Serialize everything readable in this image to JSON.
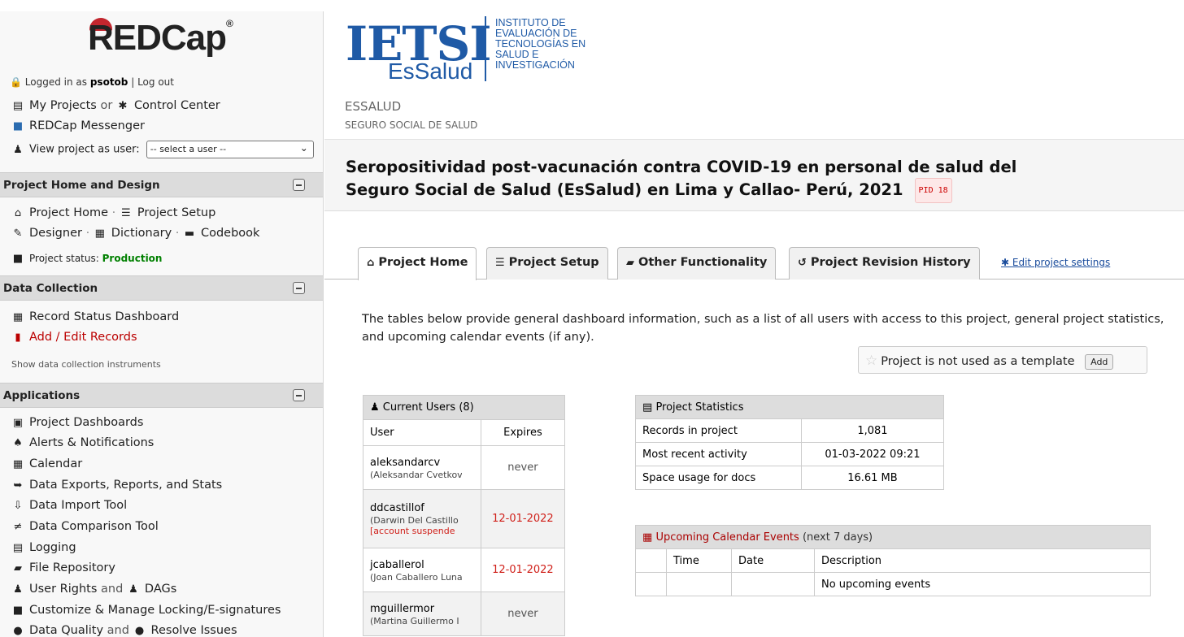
{
  "sidebar": {
    "logo": "REDCap",
    "logged_in_prefix": "Logged in as",
    "username": "psotob",
    "logout": "Log out",
    "my_projects": "My Projects",
    "or": "or",
    "control_center": "Control Center",
    "messenger": "REDCap Messenger",
    "view_as_label": "View project as user:",
    "view_as_select": "-- select a user --",
    "sections": {
      "home_design": "Project Home and Design",
      "data_collection": "Data Collection",
      "applications": "Applications"
    },
    "project_home": "Project Home",
    "project_setup": "Project Setup",
    "designer": "Designer",
    "dictionary": "Dictionary",
    "codebook": "Codebook",
    "status_label": "Project status:",
    "status_value": "Production",
    "record_status_dashboard": "Record Status Dashboard",
    "add_edit_records": "Add / Edit Records",
    "show_instruments": "Show data collection instruments",
    "apps": [
      "Project Dashboards",
      "Alerts & Notifications",
      "Calendar",
      "Data Exports, Reports, and Stats",
      "Data Import Tool",
      "Data Comparison Tool",
      "Logging",
      "File Repository"
    ],
    "user_rights": "User Rights",
    "and": "and",
    "dags": "DAGs",
    "locking": "Customize & Manage Locking/E-signatures",
    "data_quality": "Data Quality",
    "resolve_issues": "Resolve Issues"
  },
  "header": {
    "logo_main": "IETSI",
    "logo_sub": "EsSalud",
    "inst_lines": [
      "INSTITUTO DE",
      "EVALUACIÓN DE",
      "TECNOLOGÍAS EN",
      "SALUD E",
      "INVESTIGACIÓN"
    ],
    "institution": "ESSALUD",
    "institution_sub": "SEGURO SOCIAL DE SALUD"
  },
  "project": {
    "title_line1": "Seropositividad post-vacunación contra COVID-19 en personal de salud del",
    "title_line2": "Seguro Social de Salud (EsSalud) en Lima y Callao- Perú, 2021",
    "pid": "PID 18"
  },
  "tabs": {
    "home": "Project Home",
    "setup": "Project Setup",
    "other": "Other Functionality",
    "revision": "Project Revision History",
    "edit_settings": "Edit project settings"
  },
  "intro": "The tables below provide general dashboard information, such as a list of all users with access to this project, general project statistics, and upcoming calendar events (if any).",
  "template": {
    "text": "Project is not used as a template",
    "add": "Add"
  },
  "users": {
    "title": "Current Users",
    "count": "(8)",
    "col_user": "User",
    "col_expires": "Expires",
    "rows": [
      {
        "username": "aleksandarcv",
        "fullname": "(Aleksandar Cvetkov",
        "expires": "never"
      },
      {
        "username": "ddcastillof",
        "fullname": "(Darwin Del Castillo",
        "extra": "[account suspende",
        "expires": "12-01-2022"
      },
      {
        "username": "jcaballerol",
        "fullname": "(Joan Caballero Luna",
        "expires": "12-01-2022"
      },
      {
        "username": "mguillermor",
        "fullname": "(Martina Guillermo I",
        "expires": "never"
      }
    ]
  },
  "stats": {
    "title": "Project Statistics",
    "rows": [
      {
        "label": "Records in project",
        "value": "1,081"
      },
      {
        "label": "Most recent activity",
        "value": "01-03-2022 09:21"
      },
      {
        "label": "Space usage for docs",
        "value": "16.61 MB"
      }
    ]
  },
  "calendar": {
    "title": "Upcoming Calendar Events",
    "note": "(next 7 days)",
    "col_time": "Time",
    "col_date": "Date",
    "col_desc": "Description",
    "empty": "No upcoming events"
  },
  "colors": {
    "accent_blue": "#1f5aa6",
    "production_green": "#008000",
    "suspended_red": "#d0201a"
  }
}
